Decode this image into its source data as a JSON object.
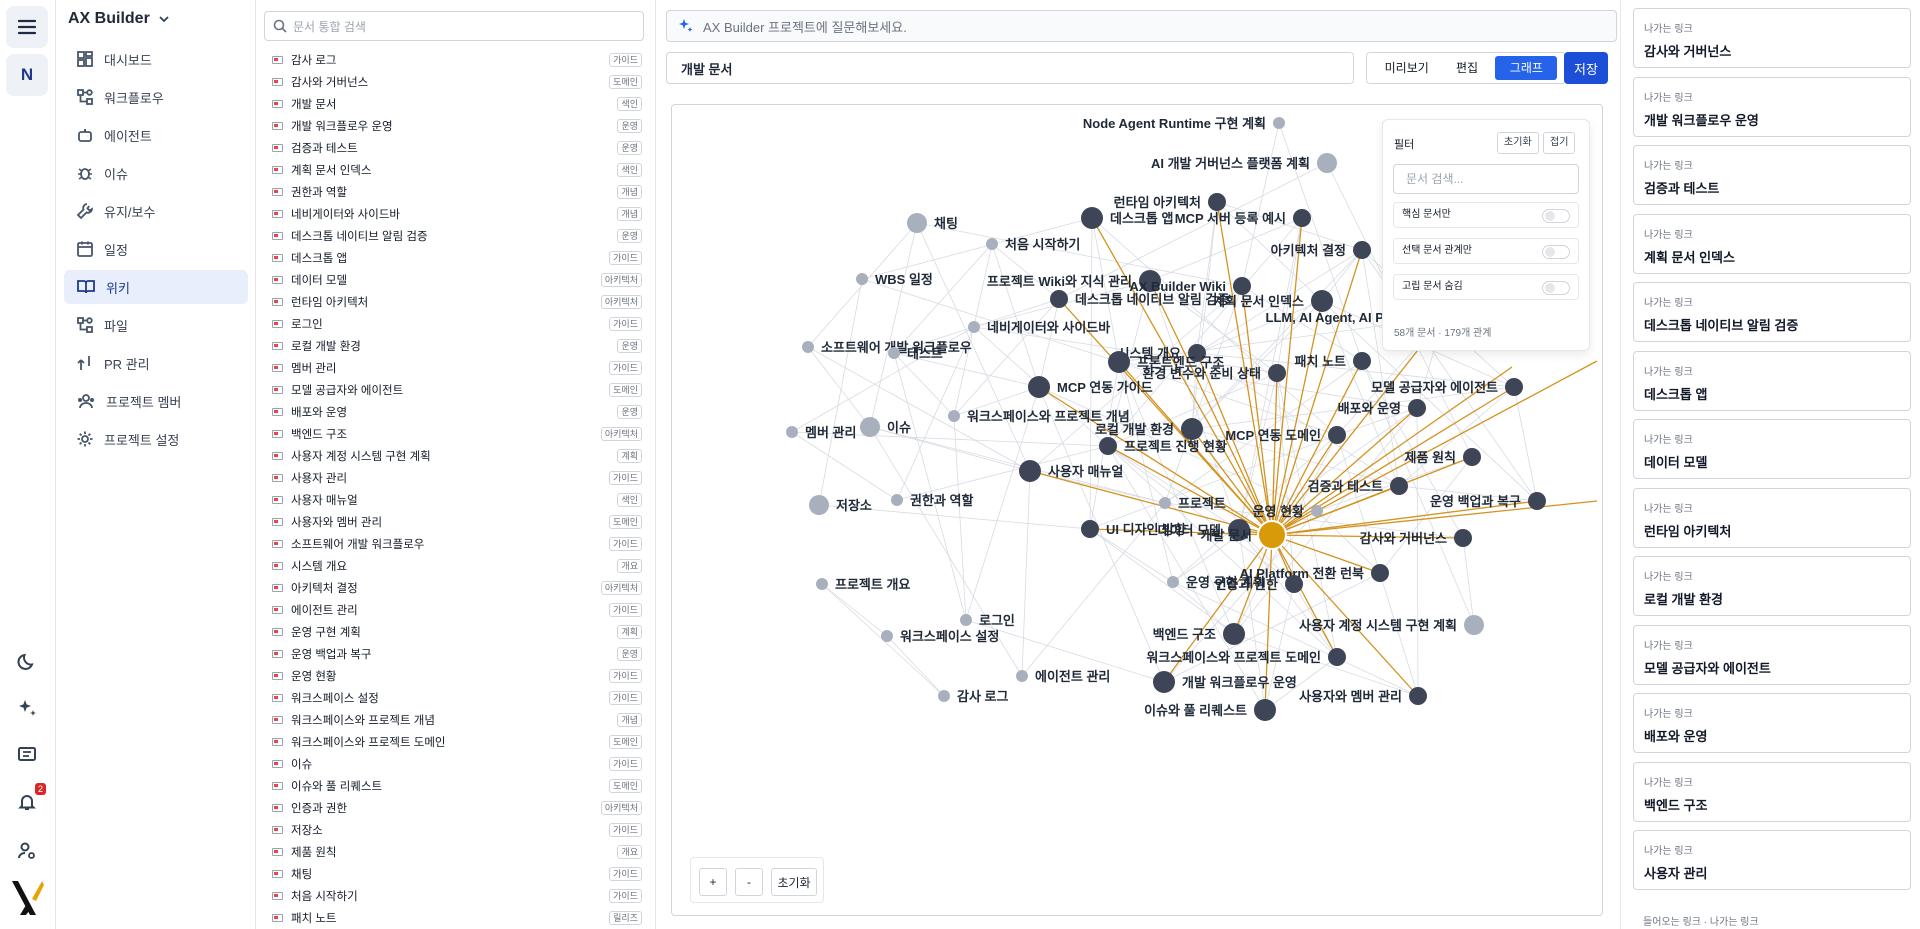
{
  "app": {
    "title": "AX Builder",
    "notification_count": "2"
  },
  "rail": {
    "project_initial": "N"
  },
  "sidebar": {
    "items": [
      {
        "label": "대시보드",
        "icon": "dashboard-icon"
      },
      {
        "label": "워크플로우",
        "icon": "workflow-icon"
      },
      {
        "label": "에이전트",
        "icon": "bot-icon"
      },
      {
        "label": "이슈",
        "icon": "bug-icon"
      },
      {
        "label": "유지/보수",
        "icon": "wrench-icon"
      },
      {
        "label": "일정",
        "icon": "calendar-icon"
      },
      {
        "label": "위키",
        "icon": "book-icon",
        "active": true
      },
      {
        "label": "파일",
        "icon": "workflow-icon"
      },
      {
        "label": "PR 관리",
        "icon": "git-pr-icon"
      },
      {
        "label": "프로젝트 멤버",
        "icon": "users-icon"
      },
      {
        "label": "프로젝트 설정",
        "icon": "gear-icon"
      }
    ]
  },
  "doclist": {
    "search_placeholder": "문서 통합 검색",
    "docs": [
      {
        "title": "감사 로그",
        "tag": "가이드"
      },
      {
        "title": "감사와 거버넌스",
        "tag": "도메인"
      },
      {
        "title": "개발 문서",
        "tag": "색인"
      },
      {
        "title": "개발 워크플로우 운영",
        "tag": "운영"
      },
      {
        "title": "검증과 테스트",
        "tag": "운영"
      },
      {
        "title": "계획 문서 인덱스",
        "tag": "색인"
      },
      {
        "title": "권한과 역할",
        "tag": "개념"
      },
      {
        "title": "네비게이터와 사이드바",
        "tag": "개념"
      },
      {
        "title": "데스크톱 네이티브 알림 검증",
        "tag": "운영"
      },
      {
        "title": "데스크톱 앱",
        "tag": "가이드"
      },
      {
        "title": "데이터 모델",
        "tag": "아키텍처"
      },
      {
        "title": "런타임 아키텍처",
        "tag": "아키텍처"
      },
      {
        "title": "로그인",
        "tag": "가이드"
      },
      {
        "title": "로컬 개발 환경",
        "tag": "운영"
      },
      {
        "title": "멤버 관리",
        "tag": "가이드"
      },
      {
        "title": "모델 공급자와 에이전트",
        "tag": "도메인"
      },
      {
        "title": "배포와 운영",
        "tag": "운영"
      },
      {
        "title": "백엔드 구조",
        "tag": "아키텍처"
      },
      {
        "title": "사용자 계정 시스템 구현 계획",
        "tag": "계획"
      },
      {
        "title": "사용자 관리",
        "tag": "가이드"
      },
      {
        "title": "사용자 매뉴얼",
        "tag": "색인"
      },
      {
        "title": "사용자와 멤버 관리",
        "tag": "도메인"
      },
      {
        "title": "소프트웨어 개발 워크플로우",
        "tag": "가이드"
      },
      {
        "title": "시스템 개요",
        "tag": "개요"
      },
      {
        "title": "아키텍처 결정",
        "tag": "아키텍처"
      },
      {
        "title": "에이전트 관리",
        "tag": "가이드"
      },
      {
        "title": "운영 구현 계획",
        "tag": "계획"
      },
      {
        "title": "운영 백업과 복구",
        "tag": "운영"
      },
      {
        "title": "운영 현황",
        "tag": "가이드"
      },
      {
        "title": "워크스페이스 설정",
        "tag": "가이드"
      },
      {
        "title": "워크스페이스와 프로젝트 개념",
        "tag": "개념"
      },
      {
        "title": "워크스페이스와 프로젝트 도메인",
        "tag": "도메인"
      },
      {
        "title": "이슈",
        "tag": "가이드"
      },
      {
        "title": "이슈와 풀 리퀘스트",
        "tag": "도메인"
      },
      {
        "title": "인증과 권한",
        "tag": "아키텍처"
      },
      {
        "title": "저장소",
        "tag": "가이드"
      },
      {
        "title": "제품 원칙",
        "tag": "개요"
      },
      {
        "title": "채팅",
        "tag": "가이드"
      },
      {
        "title": "처음 시작하기",
        "tag": "가이드"
      },
      {
        "title": "패치 노트",
        "tag": "릴리즈"
      }
    ]
  },
  "main": {
    "ask_placeholder": "AX Builder 프로젝트에 질문해보세요.",
    "doc_title": "개발 문서",
    "modes": [
      "미리보기",
      "편집",
      "그래프"
    ],
    "active_mode": "그래프",
    "save_label": "저장"
  },
  "filter": {
    "title": "필터",
    "reset_label": "초기화",
    "collapse_label": "접기",
    "search_placeholder": "문서 검색...",
    "toggles": [
      "핵심 문서만",
      "선택 문서 관계만",
      "고립 문서 숨김"
    ],
    "stats": "58개 문서 · 179개 관계"
  },
  "zoom": {
    "in_label": "+",
    "out_label": "-",
    "reset_label": "초기화"
  },
  "graph": {
    "colors": {
      "center": "#d99a0a",
      "core": "#3d4557",
      "leaf": "#a9b0bd",
      "edge_center": "#d49320",
      "edge_other": "#d7dbe2"
    },
    "center": {
      "label": "개발 문서"
    },
    "nodes": [
      {
        "label": "Node Agent Runtime 구현 계획",
        "kind": "leaf"
      },
      {
        "label": "AI 개발 거버넌스 플랫폼 계획",
        "kind": "leaf"
      },
      {
        "label": "런타임 아키텍처",
        "kind": "core"
      },
      {
        "label": "데스크톱 앱",
        "kind": "core"
      },
      {
        "label": "MCP 서버 등록 예시",
        "kind": "core"
      },
      {
        "label": "채팅",
        "kind": "leaf"
      },
      {
        "label": "처음 시작하기",
        "kind": "leaf"
      },
      {
        "label": "아키텍처 결정",
        "kind": "core"
      },
      {
        "label": "WBS 일정",
        "kind": "leaf"
      },
      {
        "label": "프로젝트 Wiki와 지식 관리",
        "kind": "core"
      },
      {
        "label": "AX Builder Wiki",
        "kind": "core"
      },
      {
        "label": "데스크톱 네이티브 알림 검증",
        "kind": "core"
      },
      {
        "label": "계획 문서 인덱스",
        "kind": "core"
      },
      {
        "label": "LLM, AI Agent, AI Platform",
        "kind": "core"
      },
      {
        "label": "네비게이터와 사이드바",
        "kind": "leaf"
      },
      {
        "label": "소프트웨어 개발 워크플로우",
        "kind": "leaf"
      },
      {
        "label": "테스트",
        "kind": "leaf"
      },
      {
        "label": "시스템 개요",
        "kind": "core"
      },
      {
        "label": "프론트엔드 구조",
        "kind": "core"
      },
      {
        "label": "환경 변수와 준비 상태",
        "kind": "core"
      },
      {
        "label": "패치 노트",
        "kind": "core"
      },
      {
        "label": "MCP 연동 가이드",
        "kind": "core"
      },
      {
        "label": "모델 공급자와 에이전트",
        "kind": "core"
      },
      {
        "label": "배포와 운영",
        "kind": "core"
      },
      {
        "label": "멤버 관리",
        "kind": "leaf"
      },
      {
        "label": "이슈",
        "kind": "leaf"
      },
      {
        "label": "워크스페이스와 프로젝트 개념",
        "kind": "leaf"
      },
      {
        "label": "로컬 개발 환경",
        "kind": "core"
      },
      {
        "label": "MCP 연동 도메인",
        "kind": "core"
      },
      {
        "label": "프로젝트 진행 현황",
        "kind": "core"
      },
      {
        "label": "사용자 매뉴얼",
        "kind": "core"
      },
      {
        "label": "제품 원칙",
        "kind": "core"
      },
      {
        "label": "검증과 테스트",
        "kind": "core"
      },
      {
        "label": "저장소",
        "kind": "leaf"
      },
      {
        "label": "권한과 역할",
        "kind": "leaf"
      },
      {
        "label": "프로젝트",
        "kind": "leaf"
      },
      {
        "label": "운영 현황",
        "kind": "leaf"
      },
      {
        "label": "운영 백업과 복구",
        "kind": "core"
      },
      {
        "label": "UI 디자인 방향",
        "kind": "core"
      },
      {
        "label": "데이터 모델",
        "kind": "core"
      },
      {
        "label": "감사와 거버넌스",
        "kind": "core"
      },
      {
        "label": "AI Platform 전환 런북",
        "kind": "core"
      },
      {
        "label": "프로젝트 개요",
        "kind": "leaf"
      },
      {
        "label": "운영 구현 계획",
        "kind": "leaf"
      },
      {
        "label": "인증과 권한",
        "kind": "core"
      },
      {
        "label": "사용자 계정 시스템 구현 계획",
        "kind": "leaf"
      },
      {
        "label": "로그인",
        "kind": "leaf"
      },
      {
        "label": "워크스페이스 설정",
        "kind": "leaf"
      },
      {
        "label": "백엔드 구조",
        "kind": "core"
      },
      {
        "label": "워크스페이스와 프로젝트 도메인",
        "kind": "core"
      },
      {
        "label": "에이전트 관리",
        "kind": "leaf"
      },
      {
        "label": "개발 워크플로우 운영",
        "kind": "core"
      },
      {
        "label": "감사 로그",
        "kind": "leaf"
      },
      {
        "label": "사용자와 멤버 관리",
        "kind": "core"
      },
      {
        "label": "이슈와 풀 리퀘스트",
        "kind": "core"
      }
    ]
  },
  "links": {
    "caption": "나가는 링크",
    "items": [
      "감사와 거버넌스",
      "개발 워크플로우 운영",
      "검증과 테스트",
      "계획 문서 인덱스",
      "데스크톱 네이티브 알림 검증",
      "데스크톱 앱",
      "데이터 모델",
      "런타임 아키텍처",
      "로컬 개발 환경",
      "모델 공급자와 에이전트",
      "배포와 운영",
      "백엔드 구조",
      "사용자 관리"
    ],
    "footer": "들어오는 링크 · 나가는 링크"
  }
}
